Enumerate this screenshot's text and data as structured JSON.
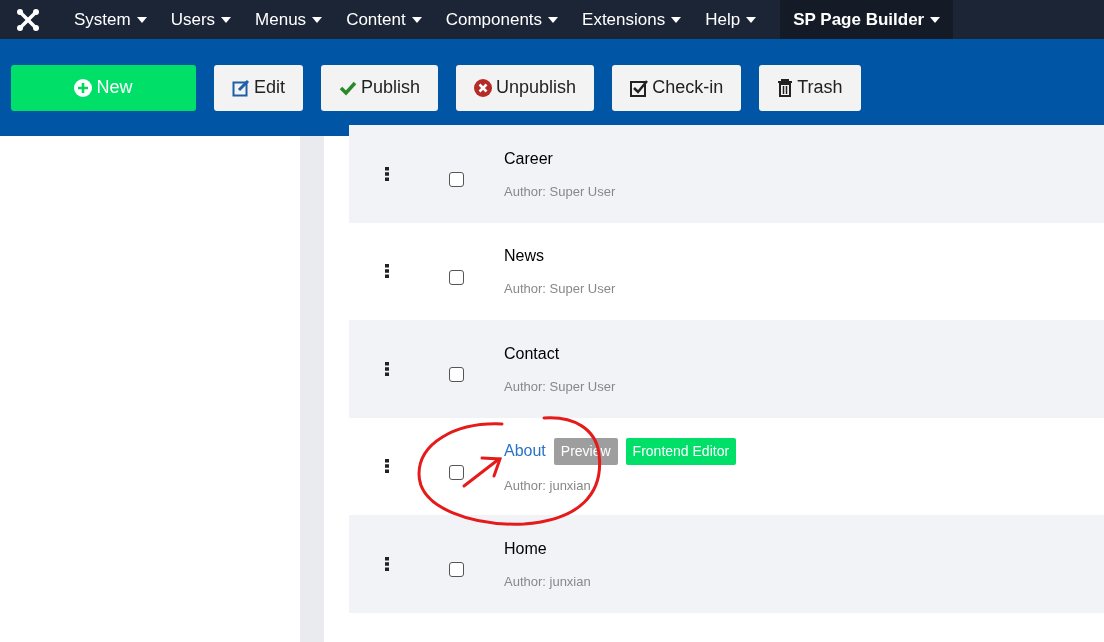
{
  "menu": [
    {
      "label": "System",
      "selected": false
    },
    {
      "label": "Users",
      "selected": false
    },
    {
      "label": "Menus",
      "selected": false
    },
    {
      "label": "Content",
      "selected": false
    },
    {
      "label": "Components",
      "selected": false
    },
    {
      "label": "Extensions",
      "selected": false
    },
    {
      "label": "Help",
      "selected": false
    },
    {
      "label": "SP Page Builder",
      "selected": true
    }
  ],
  "toolbar": [
    {
      "label": "New",
      "kind": "new"
    },
    {
      "label": "Edit",
      "kind": "edit"
    },
    {
      "label": "Publish",
      "kind": "publish"
    },
    {
      "label": "Unpublish",
      "kind": "unpublish"
    },
    {
      "label": "Check-in",
      "kind": "checkin"
    },
    {
      "label": "Trash",
      "kind": "trash"
    }
  ],
  "rows": [
    {
      "title": "Career",
      "author": "Author: Super User",
      "checked": false,
      "highlighted": false,
      "badges": []
    },
    {
      "title": "News",
      "author": "Author: Super User",
      "checked": false,
      "highlighted": false,
      "badges": []
    },
    {
      "title": "Contact",
      "author": "Author: Super User",
      "checked": false,
      "highlighted": false,
      "badges": []
    },
    {
      "title": "About",
      "author": "Author: junxian",
      "checked": false,
      "highlighted": true,
      "badges": [
        {
          "label": "Preview",
          "kind": "preview"
        },
        {
          "label": "Frontend Editor",
          "kind": "editor"
        }
      ]
    },
    {
      "title": "Home",
      "author": "Author: junxian",
      "checked": false,
      "highlighted": false,
      "badges": []
    }
  ]
}
